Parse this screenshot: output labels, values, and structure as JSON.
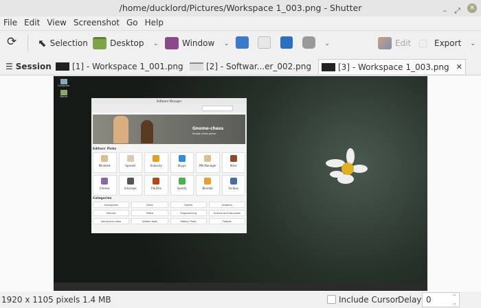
{
  "window": {
    "title": "/home/ducklord/Pictures/Workspace 1_003.png - Shutter"
  },
  "menu": [
    "File",
    "Edit",
    "View",
    "Screenshot",
    "Go",
    "Help"
  ],
  "toolbar": {
    "selection": "Selection",
    "desktop": "Desktop",
    "window": "Window",
    "edit": "Edit",
    "export": "Export"
  },
  "tabs": {
    "session": "Session",
    "items": [
      "[1] - Workspace 1_001.png",
      "[2] - Softwar...er_002.png",
      "[3] - Workspace 1_003.png"
    ],
    "active": 2
  },
  "screenshot": {
    "desktop_icons": [
      "Computer",
      "Home"
    ],
    "app_title": "Software Manager",
    "banner_title": "Gnome-chess",
    "banner_sub": "Simple chess game",
    "editors_picks": "Editors' Picks",
    "apps": [
      "Minetest",
      "Sparkel",
      "Audacity",
      "Skype",
      "PIN Manager",
      "Wine",
      "Cheese",
      "Inkscape",
      "FileZilla",
      "Spotify",
      "Blender",
      "Scribus"
    ],
    "app_colors": [
      "#d9c08f",
      "#d8cbb0",
      "#e0a020",
      "#2f8fd8",
      "#d9c08f",
      "#8c4a2a",
      "#8a6aa0",
      "#555",
      "#b44a1a",
      "#4caf50",
      "#e8a030",
      "#4a6aa8"
    ],
    "categories_label": "Categories",
    "categories": [
      "Accessories",
      "Fonts",
      "Games",
      "Graphics",
      "Internet",
      "Office",
      "Programming",
      "Science and Education",
      "Sound and video",
      "System tools",
      "Editors' Picks",
      "Flatpak"
    ]
  },
  "status": {
    "info": "1920 x 1105 pixels  1.4 MB",
    "include_cursor": "Include Cursor",
    "include_cursor_checked": false,
    "delay_label": "Delay:",
    "delay_value": "0"
  }
}
